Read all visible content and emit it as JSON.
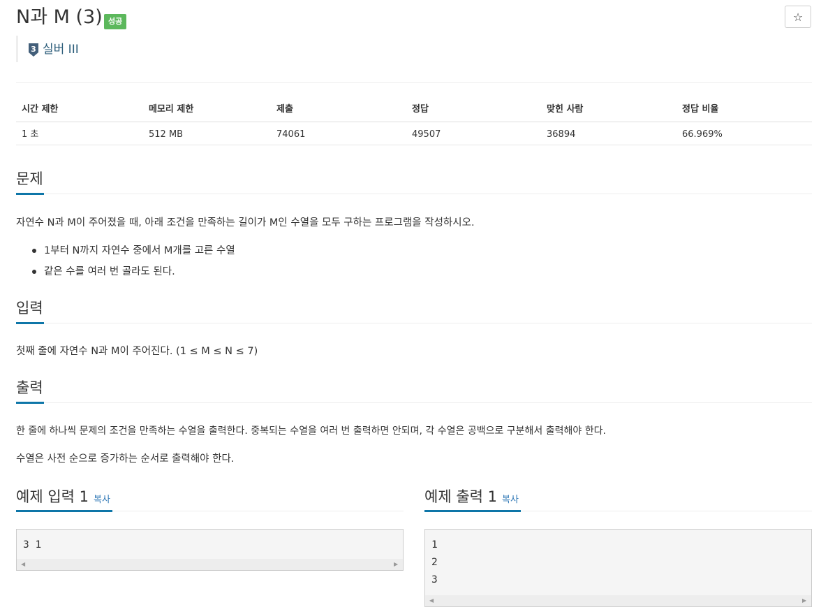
{
  "header": {
    "title": "N과 M (3)",
    "status_badge": "성공",
    "star_icon": "☆",
    "tier_number": "3",
    "tier_label": "실버 III"
  },
  "stats": {
    "headers": [
      "시간 제한",
      "메모리 제한",
      "제출",
      "정답",
      "맞힌 사람",
      "정답 비율"
    ],
    "values": [
      "1 초",
      "512 MB",
      "74061",
      "49507",
      "36894",
      "66.969%"
    ]
  },
  "problem": {
    "heading": "문제",
    "description": "자연수 N과 M이 주어졌을 때, 아래 조건을 만족하는 길이가 M인 수열을 모두 구하는 프로그램을 작성하시오.",
    "conditions": [
      "1부터 N까지 자연수 중에서 M개를 고른 수열",
      "같은 수를 여러 번 골라도 된다."
    ]
  },
  "input": {
    "heading": "입력",
    "description": "첫째 줄에 자연수 N과 M이 주어진다. (1 ≤ M ≤ N ≤ 7)"
  },
  "output": {
    "heading": "출력",
    "paragraphs": [
      "한 줄에 하나씩 문제의 조건을 만족하는 수열을 출력한다. 중복되는 수열을 여러 번 출력하면 안되며, 각 수열은 공백으로 구분해서 출력해야 한다.",
      "수열은 사전 순으로 증가하는 순서로 출력해야 한다."
    ]
  },
  "sample_input": {
    "heading": "예제 입력 1",
    "copy_label": "복사",
    "lines": [
      "3 1"
    ]
  },
  "sample_output": {
    "heading": "예제 출력 1",
    "copy_label": "복사",
    "lines": [
      "1",
      "2",
      "3"
    ]
  },
  "colors": {
    "accent": "#0e76a8",
    "success": "#5cb85c",
    "tier": "#2c5d7a",
    "link": "#337ab7"
  }
}
